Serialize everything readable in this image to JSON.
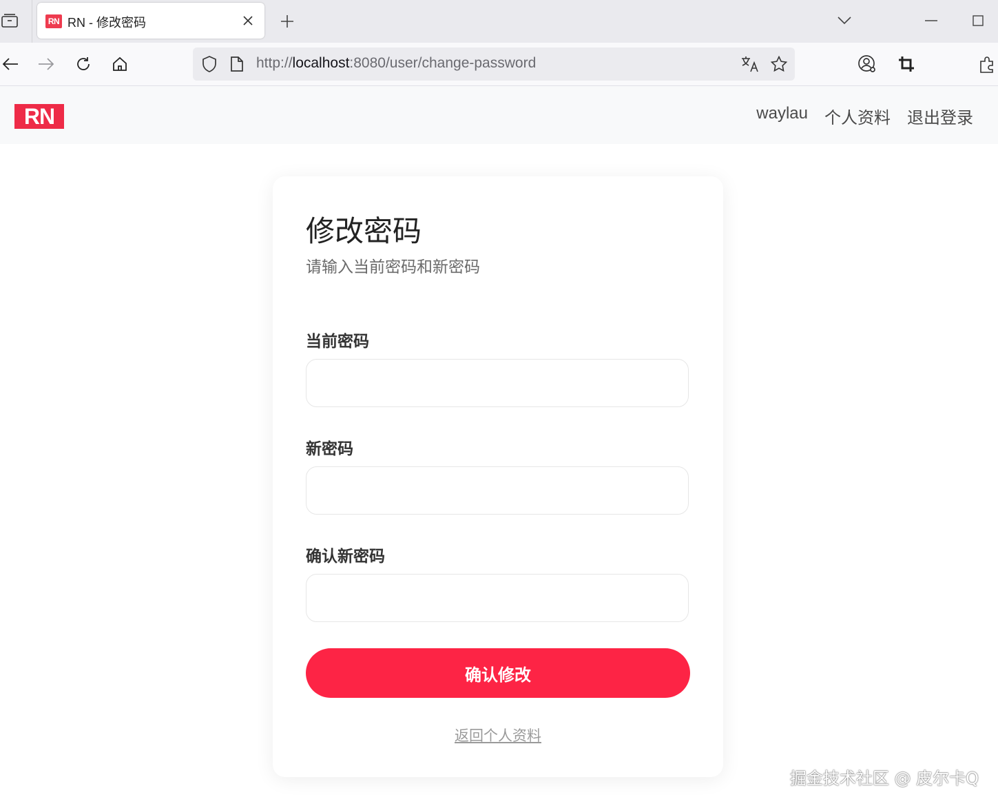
{
  "browser": {
    "tab_title": "RN - 修改密码",
    "tab_favicon_text": "RN",
    "url_prefix": "http://",
    "url_host": "localhost",
    "url_rest": ":8080/user/change-password"
  },
  "header": {
    "logo_text": "RN",
    "nav": {
      "username": "waylau",
      "profile": "个人资料",
      "logout": "退出登录"
    }
  },
  "form": {
    "title": "修改密码",
    "subtitle": "请输入当前密码和新密码",
    "current_password_label": "当前密码",
    "current_password_value": "",
    "new_password_label": "新密码",
    "new_password_value": "",
    "confirm_password_label": "确认新密码",
    "confirm_password_value": "",
    "submit_label": "确认修改",
    "back_link": "返回个人资料"
  },
  "watermark": "掘金技术社区 @ 皮尔卡Q",
  "colors": {
    "accent": "#fd2445",
    "logo_bg": "#ee2b47"
  }
}
